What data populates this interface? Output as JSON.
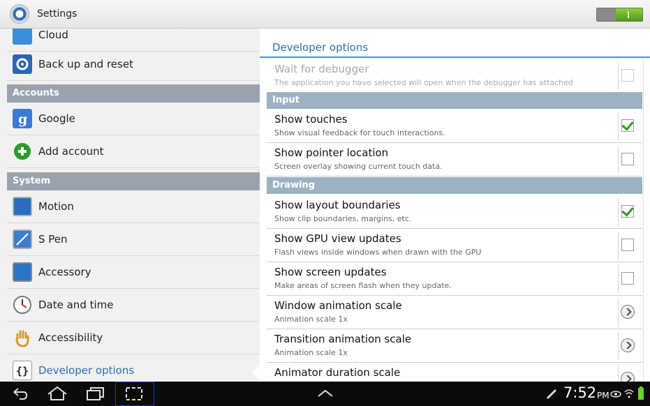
{
  "titlebar": {
    "title": "Settings"
  },
  "left": {
    "items_top": [
      {
        "label": "Cloud",
        "icon": "cloud-icon"
      },
      {
        "label": "Back up and reset",
        "icon": "backup-icon"
      }
    ],
    "sections": [
      {
        "header": "Accounts",
        "items": [
          {
            "label": "Google",
            "icon": "google-icon"
          },
          {
            "label": "Add account",
            "icon": "add-account-icon"
          }
        ]
      },
      {
        "header": "System",
        "items": [
          {
            "label": "Motion",
            "icon": "motion-icon"
          },
          {
            "label": "S Pen",
            "icon": "s-pen-icon"
          },
          {
            "label": "Accessory",
            "icon": "accessory-icon"
          },
          {
            "label": "Date and time",
            "icon": "clock-icon"
          },
          {
            "label": "Accessibility",
            "icon": "hand-icon"
          },
          {
            "label": "Developer options",
            "icon": "braces-icon"
          }
        ]
      }
    ]
  },
  "right": {
    "title": "Developer options",
    "rows": [
      {
        "title": "Wait for debugger",
        "summary": "The application you have selected will open when the debugger has attached",
        "control": "checkbox",
        "checked": false,
        "enabled": false
      },
      {
        "section": "Input"
      },
      {
        "title": "Show touches",
        "summary": "Show visual feedback for touch interactions.",
        "control": "checkbox",
        "checked": true,
        "enabled": true
      },
      {
        "title": "Show pointer location",
        "summary": "Screen overlay showing current touch data.",
        "control": "checkbox",
        "checked": false,
        "enabled": true
      },
      {
        "section": "Drawing"
      },
      {
        "title": "Show layout boundaries",
        "summary": "Show clip boundaries, margins, etc.",
        "control": "checkbox",
        "checked": true,
        "enabled": true
      },
      {
        "title": "Show GPU view updates",
        "summary": "Flash views inside windows when drawn with the GPU",
        "control": "checkbox",
        "checked": false,
        "enabled": true
      },
      {
        "title": "Show screen updates",
        "summary": "Make areas of screen flash when they update.",
        "control": "checkbox",
        "checked": false,
        "enabled": true
      },
      {
        "title": "Window animation scale",
        "summary": "Animation scale 1x",
        "control": "chevron",
        "enabled": true
      },
      {
        "title": "Transition animation scale",
        "summary": "Animation scale 1x",
        "control": "chevron",
        "enabled": true
      },
      {
        "title": "Animator duration scale",
        "summary": "",
        "control": "chevron",
        "enabled": true
      }
    ]
  },
  "statusbar": {
    "time": "7:52",
    "ampm": "PM"
  },
  "colors": {
    "accent": "#2a6fb3",
    "toggle_on": "#5aa81f",
    "section_bg": "#9bb2c4"
  }
}
